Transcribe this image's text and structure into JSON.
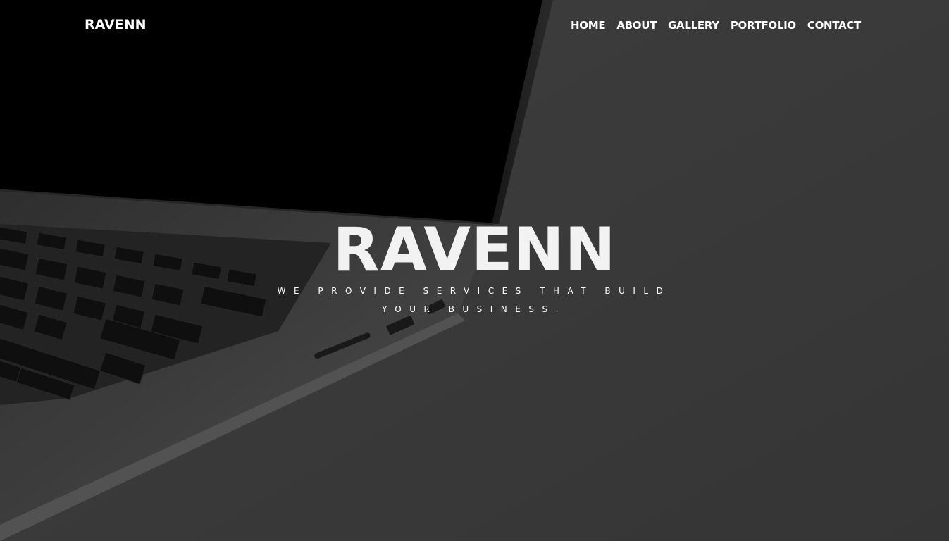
{
  "navbar": {
    "brand": "RAVENN",
    "links": [
      {
        "label": "HOME"
      },
      {
        "label": "ABOUT"
      },
      {
        "label": "GALLERY"
      },
      {
        "label": "PORTFOLIO"
      },
      {
        "label": "CONTACT"
      }
    ]
  },
  "hero": {
    "title": "RAVENN",
    "subtitle": "WE PROVIDE SERVICES THAT BUILD YOUR BUSINESS.",
    "background_image": "laptop-photo"
  },
  "colors": {
    "background": "#3f3f3f",
    "text": "#ffffff"
  }
}
